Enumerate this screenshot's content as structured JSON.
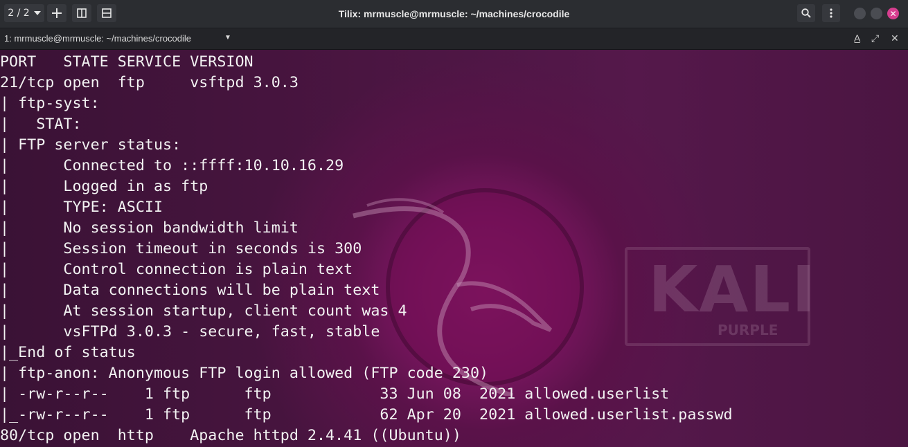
{
  "titlebar": {
    "session_label": "2 / 2",
    "title": "Tilix: mrmuscle@mrmuscle: ~/machines/crocodile",
    "icons": [
      "chevron-down-icon",
      "plus-icon",
      "split-horizontal-icon",
      "split-vertical-icon",
      "search-icon",
      "menu-icon"
    ]
  },
  "subbar": {
    "terminal_title": "1: mrmuscle@mrmuscle: ~/machines/crocodile"
  },
  "terminal": {
    "lines": [
      "PORT   STATE SERVICE VERSION",
      "21/tcp open  ftp     vsftpd 3.0.3",
      "| ftp-syst:",
      "|   STAT:",
      "| FTP server status:",
      "|      Connected to ::ffff:10.10.16.29",
      "|      Logged in as ftp",
      "|      TYPE: ASCII",
      "|      No session bandwidth limit",
      "|      Session timeout in seconds is 300",
      "|      Control connection is plain text",
      "|      Data connections will be plain text",
      "|      At session startup, client count was 4",
      "|      vsFTPd 3.0.3 - secure, fast, stable",
      "|_End of status",
      "| ftp-anon: Anonymous FTP login allowed (FTP code 230)",
      "| -rw-r--r--    1 ftp      ftp            33 Jun 08  2021 allowed.userlist",
      "|_-rw-r--r--    1 ftp      ftp            62 Apr 20  2021 allowed.userlist.passwd",
      "80/tcp open  http    Apache httpd 2.4.41 ((Ubuntu))"
    ]
  },
  "wallpaper": {
    "brand": "KALI",
    "sub": "PURPLE"
  }
}
